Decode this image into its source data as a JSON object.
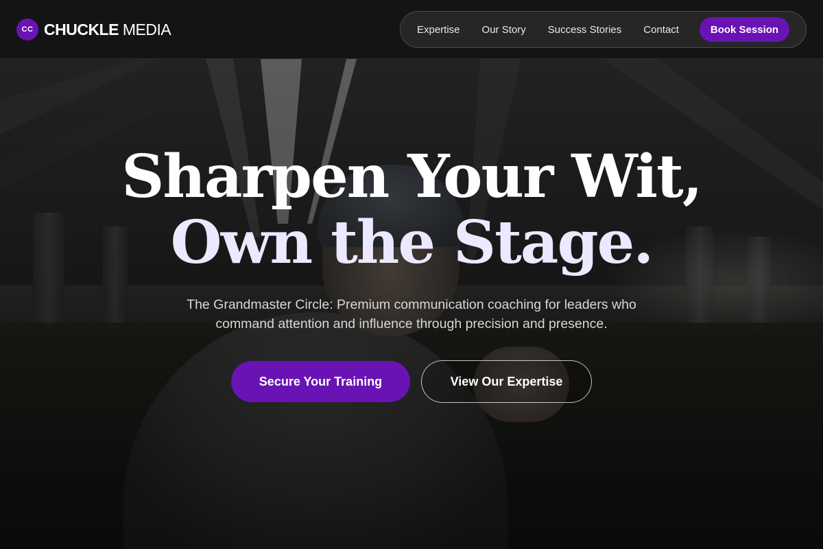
{
  "brand": {
    "badge": "CC",
    "name_bold": "CHUCKLE",
    "name_light": "MEDIA",
    "accent_color": "#6a13b5"
  },
  "nav": {
    "items": [
      {
        "label": "Expertise"
      },
      {
        "label": "Our Story"
      },
      {
        "label": "Success Stories"
      },
      {
        "label": "Contact"
      }
    ],
    "cta_label": "Book Session"
  },
  "hero": {
    "headline_line1": "Sharpen Your Wit,",
    "headline_line2": "Own the Stage.",
    "subtitle": "The Grandmaster Circle: Premium communication coaching for leaders who command attention and influence through precision and presence.",
    "primary_cta": "Secure Your Training",
    "secondary_cta": "View Our Expertise"
  },
  "colors": {
    "background": "#141414",
    "header_bg": "#141414",
    "headline_line2": "#ece8ff"
  }
}
